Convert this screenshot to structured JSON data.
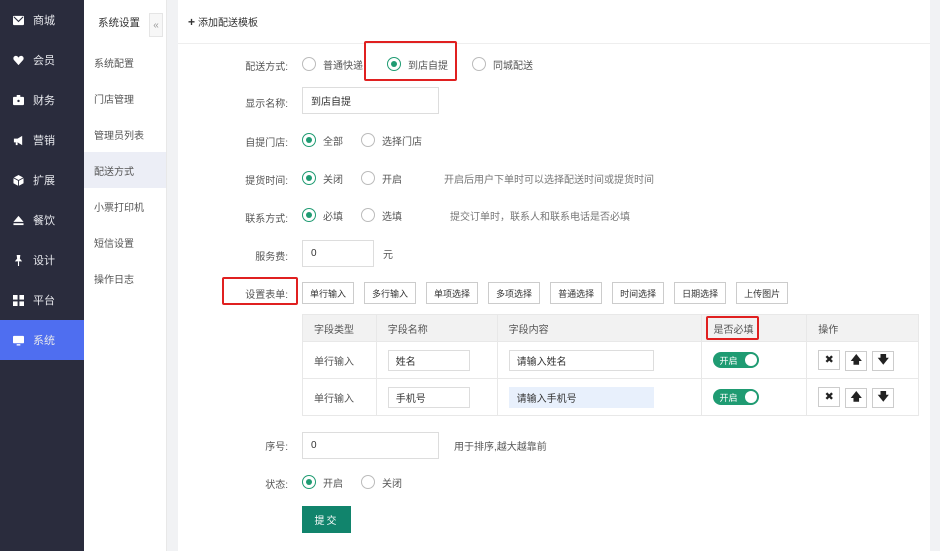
{
  "nav": [
    {
      "label": "商城",
      "icon": "envelope-icon"
    },
    {
      "label": "会员",
      "icon": "heart-icon"
    },
    {
      "label": "财务",
      "icon": "wallet-icon"
    },
    {
      "label": "营销",
      "icon": "megaphone-icon"
    },
    {
      "label": "扩展",
      "icon": "cube-icon"
    },
    {
      "label": "餐饮",
      "icon": "eject-icon"
    },
    {
      "label": "设计",
      "icon": "pin-icon"
    },
    {
      "label": "平台",
      "icon": "grid-icon"
    },
    {
      "label": "系统",
      "icon": "monitor-icon",
      "active": true
    }
  ],
  "submenu": {
    "title": "系统设置",
    "collapse": "«",
    "items": [
      "系统配置",
      "门店管理",
      "管理员列表",
      "配送方式",
      "小票打印机",
      "短信设置",
      "操作日志"
    ],
    "active_index": 3
  },
  "header": {
    "add_icon": "+",
    "add_label": "添加配送模板"
  },
  "form": {
    "delivery": {
      "label": "配送方式:",
      "options": [
        "普通快递",
        "到店自提",
        "同城配送"
      ],
      "selected": 1
    },
    "display_name": {
      "label": "显示名称:",
      "value": "到店自提"
    },
    "pickup_store": {
      "label": "自提门店:",
      "options": [
        "全部",
        "选择门店"
      ],
      "selected": 0
    },
    "pickup_time": {
      "label": "提货时间:",
      "options": [
        "关闭",
        "开启"
      ],
      "selected": 0,
      "hint": "开启后用户下单时可以选择配送时间或提货时间"
    },
    "contact": {
      "label": "联系方式:",
      "options": [
        "必填",
        "选填"
      ],
      "selected": 0,
      "hint": "提交订单时，联系人和联系电话是否必填"
    },
    "fee": {
      "label": "服务费:",
      "value": "0",
      "unit": "元"
    },
    "form_setting": {
      "label": "设置表单:",
      "buttons": [
        "单行输入",
        "多行输入",
        "单项选择",
        "多项选择",
        "普通选择",
        "时间选择",
        "日期选择",
        "上传图片"
      ]
    },
    "table": {
      "headers": [
        "字段类型",
        "字段名称",
        "字段内容",
        "是否必填",
        "操作"
      ],
      "rows": [
        {
          "type": "单行输入",
          "name": "姓名",
          "content": "请输入姓名",
          "required": "开启"
        },
        {
          "type": "单行输入",
          "name": "手机号",
          "content": "请输入手机号",
          "required": "开启"
        }
      ],
      "ops": {
        "delete": "✖",
        "up": "🡅",
        "down": "🡇"
      }
    },
    "sort": {
      "label": "序号:",
      "value": "0",
      "hint": "用于排序,越大越靠前"
    },
    "status": {
      "label": "状态:",
      "options": [
        "开启",
        "关闭"
      ],
      "selected": 0
    },
    "submit": "提交"
  },
  "colors": {
    "accent": "#1f9b72",
    "nav_bg": "#2a2c3d",
    "nav_active": "#4f6ef0",
    "highlight_box": "#e02020",
    "submit": "#11846c"
  }
}
